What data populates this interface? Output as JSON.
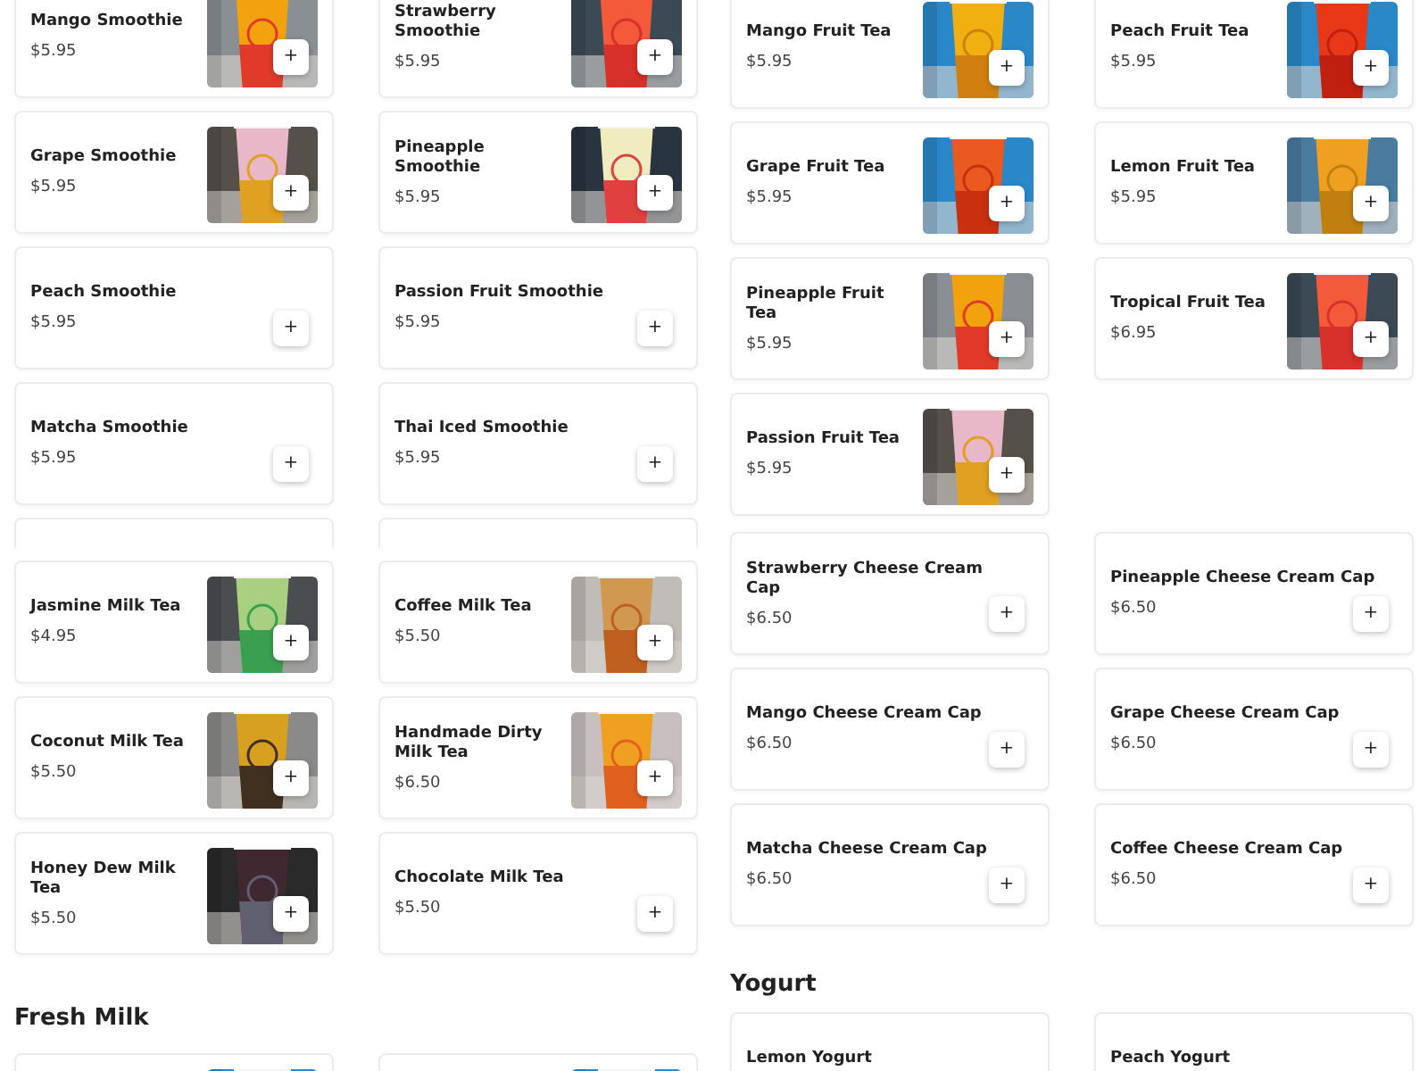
{
  "columns": [
    {
      "sections": [
        {
          "items": [
            {
              "name": "Mango Smoothie",
              "price": "$5.95",
              "photo": true,
              "button": "+"
            },
            {
              "name": "Strawberry Smoothie",
              "price": "$5.95",
              "photo": true,
              "button": "+"
            },
            {
              "name": "Grape Smoothie",
              "price": "$5.95",
              "photo": true,
              "button": "+"
            },
            {
              "name": "Pineapple Smoothie",
              "price": "$5.95",
              "photo": true,
              "button": "+"
            },
            {
              "name": "Peach Smoothie",
              "price": "$5.95",
              "photo": false,
              "button": "+"
            },
            {
              "name": "Passion Fruit Smoothie",
              "price": "$5.95",
              "photo": false,
              "button": "+"
            },
            {
              "name": "Matcha Smoothie",
              "price": "$5.95",
              "photo": false,
              "button": "+"
            },
            {
              "name": "Thai Iced Smoothie",
              "price": "$5.95",
              "photo": false,
              "button": "+"
            }
          ]
        },
        {
          "items": [
            {
              "name": "Jasmine Milk Tea",
              "price": "$4.95",
              "photo": true,
              "button": "+"
            },
            {
              "name": "Coffee Milk Tea",
              "price": "$5.50",
              "photo": true,
              "button": "+"
            },
            {
              "name": "Coconut Milk Tea",
              "price": "$5.50",
              "photo": true,
              "button": "+"
            },
            {
              "name": "Handmade Dirty Milk Tea",
              "price": "$6.50",
              "photo": true,
              "button": "+"
            },
            {
              "name": "Honey Dew Milk Tea",
              "price": "$5.50",
              "photo": true,
              "button": "+"
            },
            {
              "name": "Chocolate Milk Tea",
              "price": "$5.50",
              "photo": false,
              "button": "+"
            }
          ]
        },
        {
          "heading": "Fresh Milk",
          "items": [
            {
              "photo": true
            },
            {
              "photo": true
            }
          ]
        }
      ]
    },
    {
      "sections": [
        {
          "items": [
            {
              "name": "Mango Fruit Tea",
              "price": "$5.95",
              "photo": true,
              "button": "+"
            },
            {
              "name": "Peach Fruit Tea",
              "price": "$5.95",
              "photo": true,
              "button": "+"
            },
            {
              "name": "Grape Fruit Tea",
              "price": "$5.95",
              "photo": true,
              "button": "+"
            },
            {
              "name": "Lemon Fruit Tea",
              "price": "$5.95",
              "photo": true,
              "button": "+"
            },
            {
              "name": "Pineapple Fruit Tea",
              "price": "$5.95",
              "photo": true,
              "button": "+"
            },
            {
              "name": "Tropical Fruit Tea",
              "price": "$6.95",
              "photo": true,
              "button": "+"
            },
            {
              "name": "Passion Fruit Tea",
              "price": "$5.95",
              "photo": true,
              "button": "+"
            }
          ]
        },
        {
          "items": [
            {
              "name": "Strawberry Cheese Cream Cap",
              "price": "$6.50",
              "photo": false,
              "button": "+"
            },
            {
              "name": "Pineapple Cheese Cream Cap",
              "price": "$6.50",
              "photo": false,
              "button": "+"
            },
            {
              "name": "Mango Cheese Cream Cap",
              "price": "$6.50",
              "photo": false,
              "button": "+"
            },
            {
              "name": "Grape Cheese Cream Cap",
              "price": "$6.50",
              "photo": false,
              "button": "+"
            },
            {
              "name": "Matcha Cheese Cream Cap",
              "price": "$6.50",
              "photo": false,
              "button": "+"
            },
            {
              "name": "Coffee Cheese Cream Cap",
              "price": "$6.50",
              "photo": false,
              "button": "+"
            }
          ]
        },
        {
          "heading": "Yogurt",
          "items": [
            {
              "name": "Lemon Yogurt",
              "photo": false
            },
            {
              "name": "Peach Yogurt",
              "photo": false
            }
          ]
        }
      ]
    }
  ]
}
